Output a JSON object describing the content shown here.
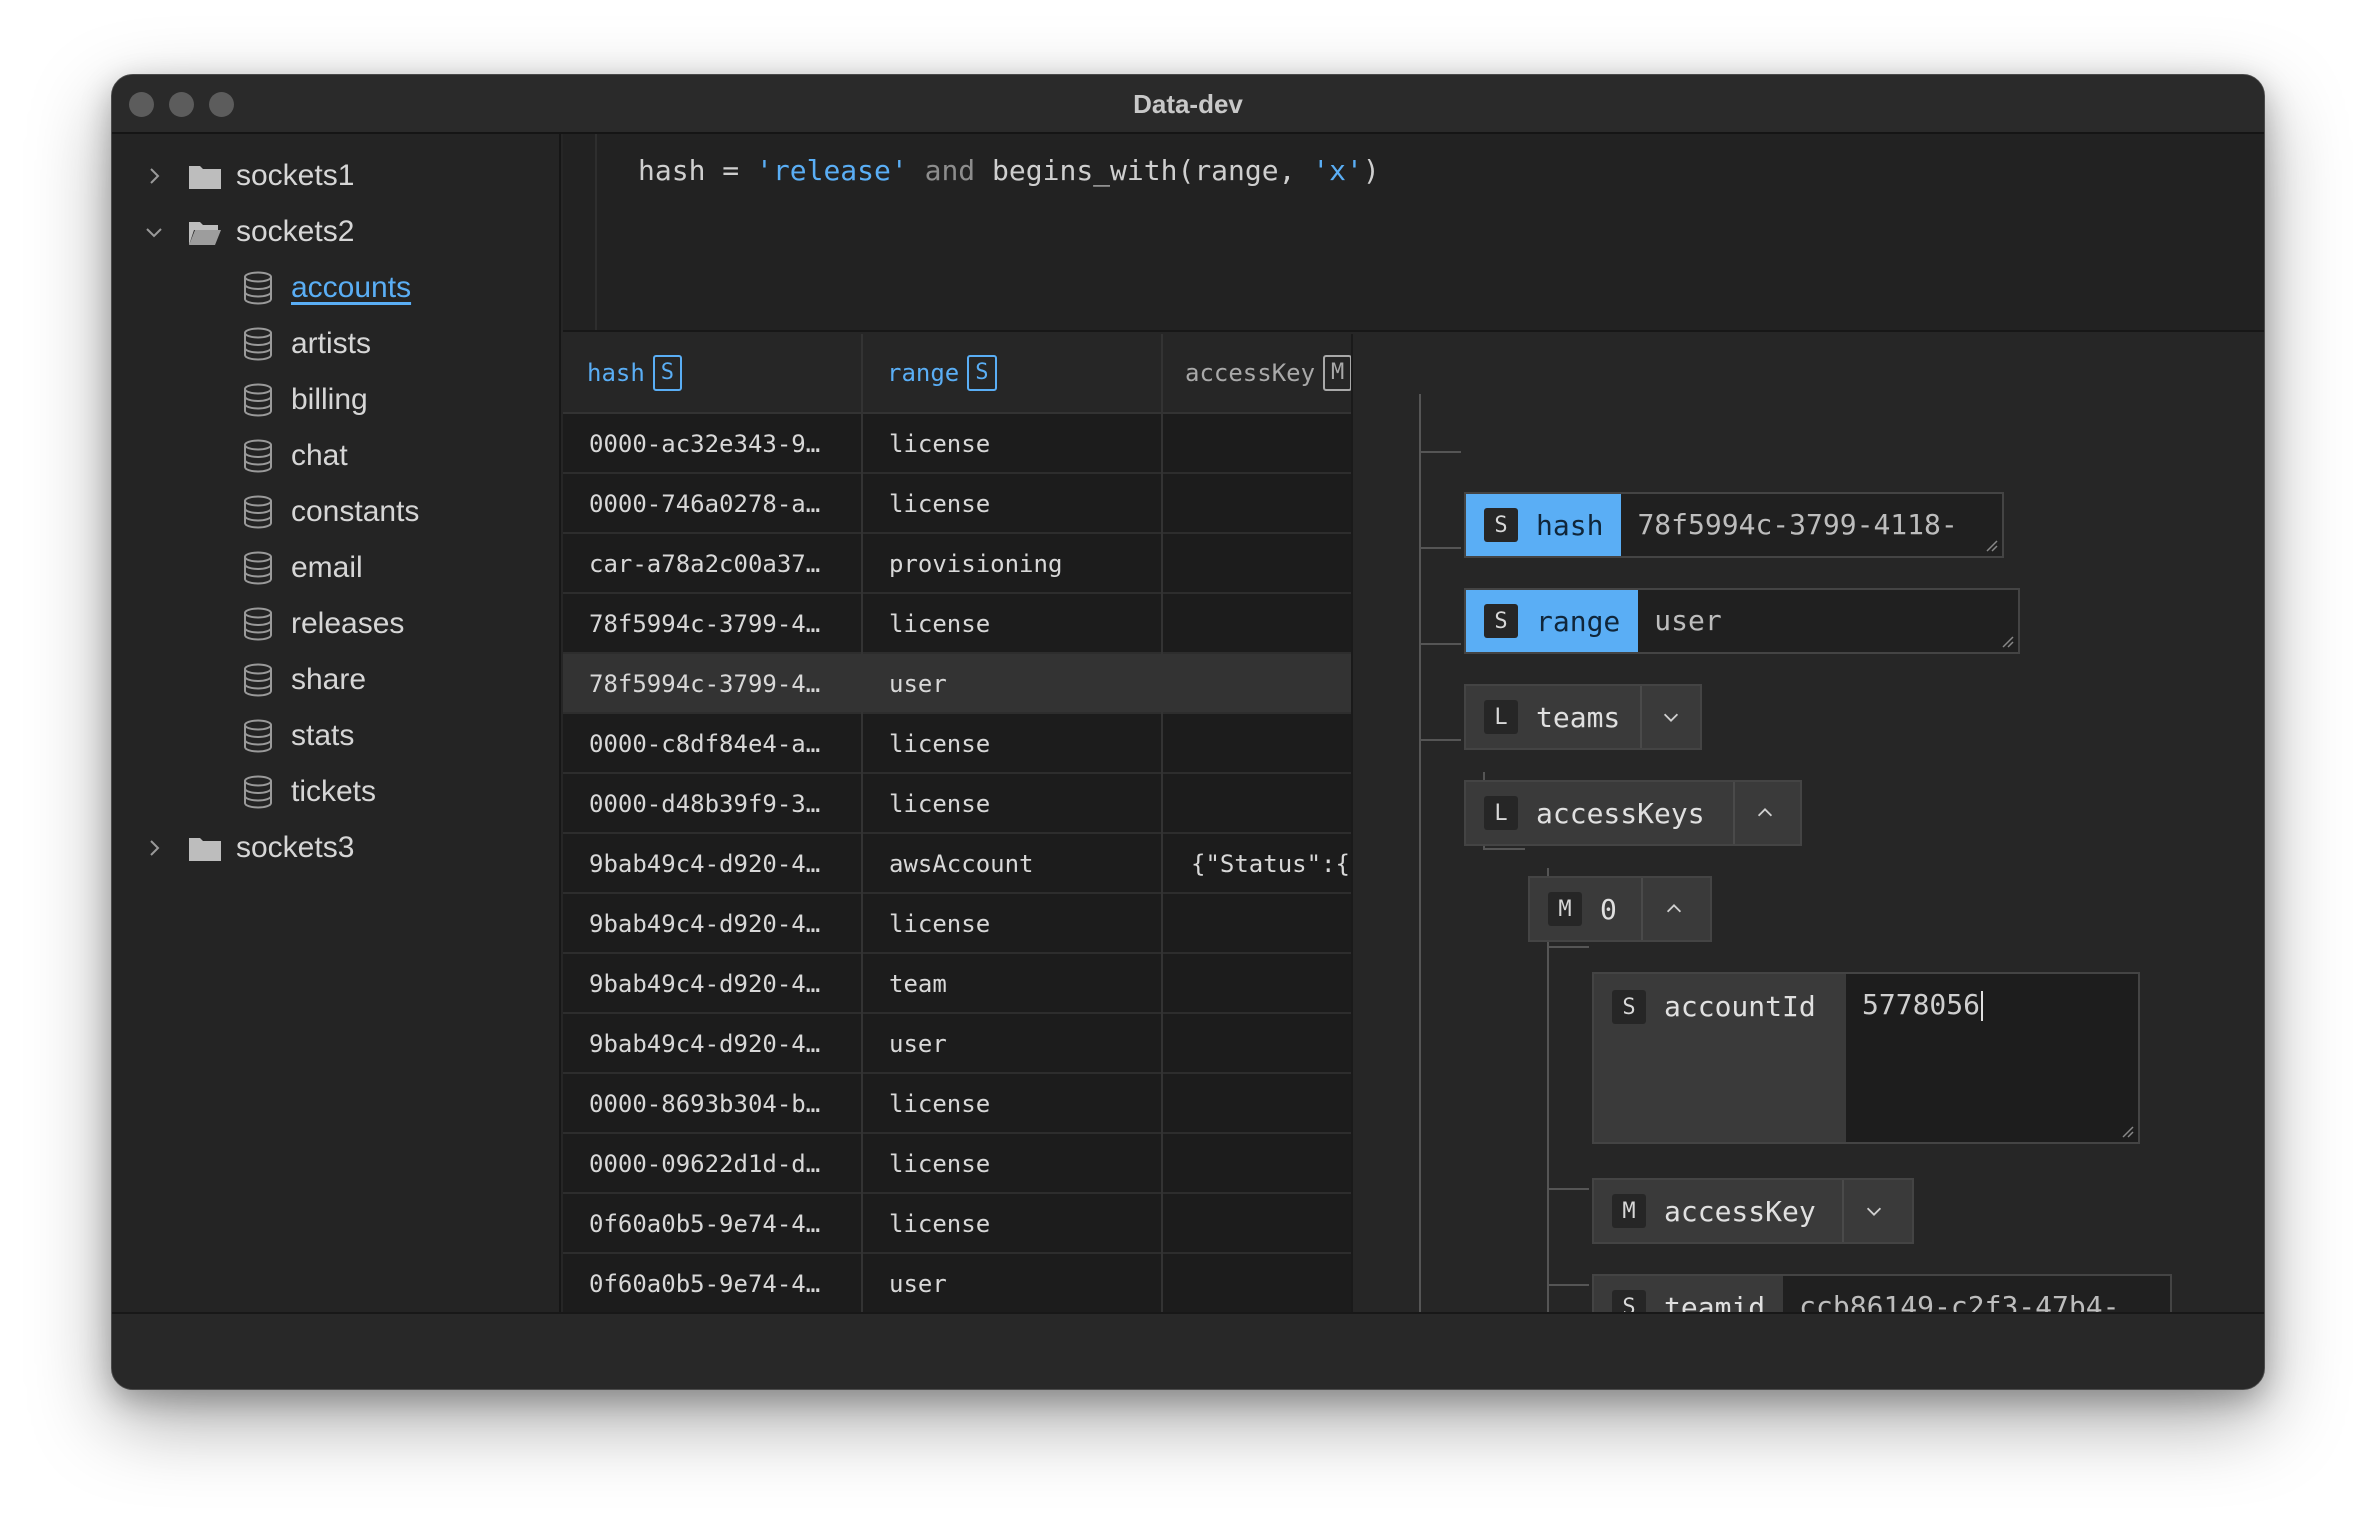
{
  "window": {
    "title": "Data-dev"
  },
  "sidebar": {
    "groups": [
      {
        "label": "sockets1",
        "expanded": false
      },
      {
        "label": "sockets2",
        "expanded": true,
        "tables": [
          "accounts",
          "artists",
          "billing",
          "chat",
          "constants",
          "email",
          "releases",
          "share",
          "stats",
          "tickets"
        ],
        "active_table": "accounts"
      },
      {
        "label": "sockets3",
        "expanded": false
      }
    ]
  },
  "query": {
    "t1": "hash = ",
    "t2": "'release'",
    "t3": " and ",
    "t4": "begins_with(range, ",
    "t5": "'x'",
    "t6": ")"
  },
  "table": {
    "columns": [
      {
        "name": "hash",
        "type": "S"
      },
      {
        "name": "range",
        "type": "S"
      },
      {
        "name": "accessKey",
        "type": "M"
      }
    ],
    "rows": [
      [
        "0000-ac32e343-9…",
        "license",
        ""
      ],
      [
        "0000-746a0278-a…",
        "license",
        ""
      ],
      [
        "car-a78a2c00a37…",
        "provisioning",
        ""
      ],
      [
        "78f5994c-3799-4…",
        "license",
        ""
      ],
      [
        "78f5994c-3799-4…",
        "user",
        ""
      ],
      [
        "0000-c8df84e4-a…",
        "license",
        ""
      ],
      [
        "0000-d48b39f9-3…",
        "license",
        ""
      ],
      [
        "9bab49c4-d920-4…",
        "awsAccount",
        "{\"Status\":{"
      ],
      [
        "9bab49c4-d920-4…",
        "license",
        ""
      ],
      [
        "9bab49c4-d920-4…",
        "team",
        ""
      ],
      [
        "9bab49c4-d920-4…",
        "user",
        ""
      ],
      [
        "0000-8693b304-b…",
        "license",
        ""
      ],
      [
        "0000-09622d1d-d…",
        "license",
        ""
      ],
      [
        "0f60a0b5-9e74-4…",
        "license",
        ""
      ],
      [
        "0f60a0b5-9e74-4…",
        "user",
        ""
      ]
    ],
    "selected_row": 4
  },
  "detail": {
    "hash": {
      "type": "S",
      "key": "hash",
      "value": "78f5994c-3799-4118-"
    },
    "range": {
      "type": "S",
      "key": "range",
      "value": "user"
    },
    "teams": {
      "type": "L",
      "key": "teams"
    },
    "accessKeys": {
      "type": "L",
      "key": "accessKeys"
    },
    "item0": {
      "type": "M",
      "key": "0"
    },
    "accountId": {
      "type": "S",
      "key": "accountId",
      "value": "5778056"
    },
    "accessKey": {
      "type": "M",
      "key": "accessKey"
    },
    "teamid": {
      "type": "S",
      "key": "teamid",
      "value": "ccb86149-c2f3-47b4-"
    }
  },
  "colors": {
    "accent": "#5aaef5",
    "background": "#262626"
  }
}
